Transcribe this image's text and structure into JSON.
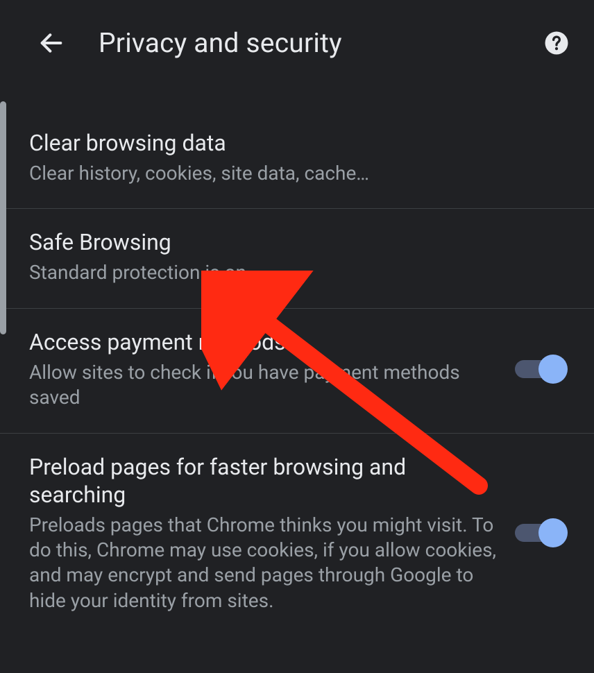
{
  "header": {
    "title": "Privacy and security"
  },
  "items": [
    {
      "title": "Clear browsing data",
      "subtitle": "Clear history, cookies, site data, cache…"
    },
    {
      "title": "Safe Browsing",
      "subtitle": "Standard protection is on"
    },
    {
      "title": "Access payment methods",
      "subtitle": "Allow sites to check if you have payment methods saved"
    },
    {
      "title": "Preload pages for faster browsing and searching",
      "subtitle": "Preloads pages that Chrome thinks you might visit. To do this, Chrome may use cookies, if you allow cookies, and may encrypt and send pages through Google to hide your identity from sites."
    }
  ]
}
